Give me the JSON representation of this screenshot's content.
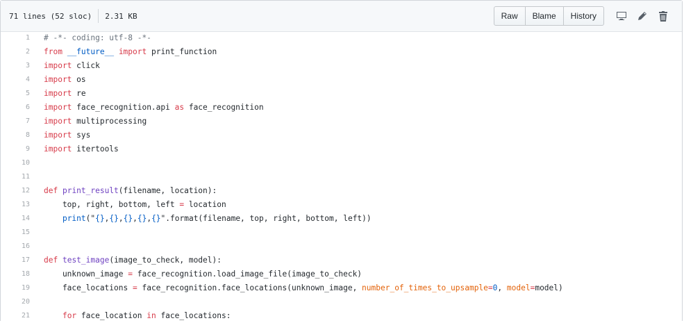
{
  "file_info": {
    "lines": "71 lines (52 sloc)",
    "size": "2.31 KB"
  },
  "actions": {
    "buttons": [
      "Raw",
      "Blame",
      "History"
    ],
    "icons": [
      "desktop-icon",
      "pencil-icon",
      "trash-icon"
    ]
  },
  "colors": {
    "keyword": "#d73a49",
    "function": "#6f42c1",
    "constant": "#005cc5",
    "string": "#032f62",
    "comment": "#6a737d",
    "param": "#e36209"
  },
  "code_lines": [
    {
      "num": "1",
      "tokens": [
        {
          "t": "# -*- coding: utf-8 -*-",
          "c": "comment"
        }
      ]
    },
    {
      "num": "2",
      "tokens": [
        {
          "t": "from",
          "c": "kw"
        },
        {
          "t": " "
        },
        {
          "t": "__future__",
          "c": "con"
        },
        {
          "t": " "
        },
        {
          "t": "import",
          "c": "kw"
        },
        {
          "t": " print_function"
        }
      ]
    },
    {
      "num": "3",
      "tokens": [
        {
          "t": "import",
          "c": "kw"
        },
        {
          "t": " click"
        }
      ]
    },
    {
      "num": "4",
      "tokens": [
        {
          "t": "import",
          "c": "kw"
        },
        {
          "t": " os"
        }
      ]
    },
    {
      "num": "5",
      "tokens": [
        {
          "t": "import",
          "c": "kw"
        },
        {
          "t": " re"
        }
      ]
    },
    {
      "num": "6",
      "tokens": [
        {
          "t": "import",
          "c": "kw"
        },
        {
          "t": " face_recognition.api "
        },
        {
          "t": "as",
          "c": "kw"
        },
        {
          "t": " face_recognition"
        }
      ]
    },
    {
      "num": "7",
      "tokens": [
        {
          "t": "import",
          "c": "kw"
        },
        {
          "t": " multiprocessing"
        }
      ]
    },
    {
      "num": "8",
      "tokens": [
        {
          "t": "import",
          "c": "kw"
        },
        {
          "t": " sys"
        }
      ]
    },
    {
      "num": "9",
      "tokens": [
        {
          "t": "import",
          "c": "kw"
        },
        {
          "t": " itertools"
        }
      ]
    },
    {
      "num": "10",
      "tokens": []
    },
    {
      "num": "11",
      "tokens": []
    },
    {
      "num": "12",
      "tokens": [
        {
          "t": "def",
          "c": "kw"
        },
        {
          "t": " "
        },
        {
          "t": "print_result",
          "c": "fn"
        },
        {
          "t": "(filename, location):"
        }
      ]
    },
    {
      "num": "13",
      "tokens": [
        {
          "t": "    top, right, bottom, left "
        },
        {
          "t": "=",
          "c": "kw"
        },
        {
          "t": " location"
        }
      ]
    },
    {
      "num": "14",
      "tokens": [
        {
          "t": "    "
        },
        {
          "t": "print",
          "c": "con"
        },
        {
          "t": "(\""
        },
        {
          "t": "{}",
          "c": "con"
        },
        {
          "t": ","
        },
        {
          "t": "{}",
          "c": "con"
        },
        {
          "t": ","
        },
        {
          "t": "{}",
          "c": "con"
        },
        {
          "t": ","
        },
        {
          "t": "{}",
          "c": "con"
        },
        {
          "t": ","
        },
        {
          "t": "{}",
          "c": "con"
        },
        {
          "t": "\".format(filename, top, right, bottom, left))"
        }
      ]
    },
    {
      "num": "15",
      "tokens": []
    },
    {
      "num": "16",
      "tokens": []
    },
    {
      "num": "17",
      "tokens": [
        {
          "t": "def",
          "c": "kw"
        },
        {
          "t": " "
        },
        {
          "t": "test_image",
          "c": "fn"
        },
        {
          "t": "(image_to_check, model):"
        }
      ]
    },
    {
      "num": "18",
      "tokens": [
        {
          "t": "    unknown_image "
        },
        {
          "t": "=",
          "c": "kw"
        },
        {
          "t": " face_recognition.load_image_file(image_to_check)"
        }
      ]
    },
    {
      "num": "19",
      "tokens": [
        {
          "t": "    face_locations "
        },
        {
          "t": "=",
          "c": "kw"
        },
        {
          "t": " face_recognition.face_locations(unknown_image, "
        },
        {
          "t": "number_of_times_to_upsample",
          "c": "param"
        },
        {
          "t": "=",
          "c": "kw"
        },
        {
          "t": "0",
          "c": "con"
        },
        {
          "t": ", "
        },
        {
          "t": "model",
          "c": "param"
        },
        {
          "t": "=",
          "c": "kw"
        },
        {
          "t": "model)"
        }
      ]
    },
    {
      "num": "20",
      "tokens": []
    },
    {
      "num": "21",
      "tokens": [
        {
          "t": "    "
        },
        {
          "t": "for",
          "c": "kw"
        },
        {
          "t": " face_location "
        },
        {
          "t": "in",
          "c": "kw"
        },
        {
          "t": " face_locations:"
        }
      ]
    }
  ]
}
